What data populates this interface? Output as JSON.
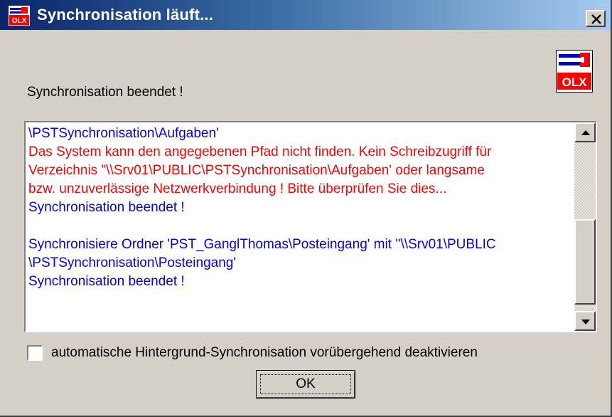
{
  "window": {
    "title": "Synchronisation läuft...",
    "close_glyph": "×"
  },
  "logo": {
    "text": "OLX",
    "icon": "olx-logo-icon"
  },
  "status": {
    "label": "Synchronisation beendet !"
  },
  "log": {
    "lines": [
      {
        "text": "\\PSTSynchronisation\\Aufgaben'",
        "color": "#0000ee"
      },
      {
        "text": "Das System kann den angegebenen Pfad nicht finden.  Kein Schreibzugriff für",
        "color": "#ff0000"
      },
      {
        "text": "Verzeichnis \"\\\\Srv01\\PUBLIC\\PSTSynchronisation\\Aufgaben' oder langsame",
        "color": "#ff0000"
      },
      {
        "text": "bzw. unzuverlässige Netzwerkverbindung ! Bitte überprüfen Sie dies...",
        "color": "#ff0000"
      },
      {
        "text": "Synchronisation beendet !",
        "color": "#0000ee"
      },
      {
        "text": "",
        "color": "#0000ee"
      },
      {
        "text": "Synchronisiere Ordner 'PST_GanglThomas\\Posteingang' mit ''\\\\Srv01\\PUBLIC",
        "color": "#0000ee"
      },
      {
        "text": "\\PSTSynchronisation\\Posteingang'",
        "color": "#0000ee"
      },
      {
        "text": "Synchronisation beendet !",
        "color": "#0000ee"
      }
    ]
  },
  "checkbox": {
    "label": "automatische Hintergrund-Synchronisation vorübergehend deaktivieren",
    "checked": false
  },
  "buttons": {
    "ok_label": "OK"
  },
  "colors": {
    "titlebar_start": "#0a246a",
    "titlebar_end": "#a6caf0",
    "log_info": "#0000ee",
    "log_error": "#ff0000",
    "dialog_bg": "#d4d0c8"
  }
}
